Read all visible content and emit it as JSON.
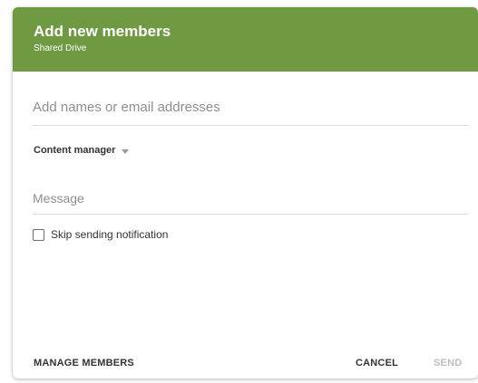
{
  "dialog": {
    "title": "Add new members",
    "subtitle": "Shared Drive",
    "header_color": "#6f9a42"
  },
  "names_field": {
    "value": "",
    "placeholder": "Add names or email addresses"
  },
  "role_select": {
    "selected": "Content manager",
    "icon": "chevron-down-icon"
  },
  "message_field": {
    "value": "",
    "placeholder": "Message"
  },
  "skip_notification": {
    "label": "Skip sending notification",
    "checked": false
  },
  "actions": {
    "manage_label": "MANAGE MEMBERS",
    "cancel_label": "CANCEL",
    "send_label": "SEND",
    "send_enabled": false
  }
}
